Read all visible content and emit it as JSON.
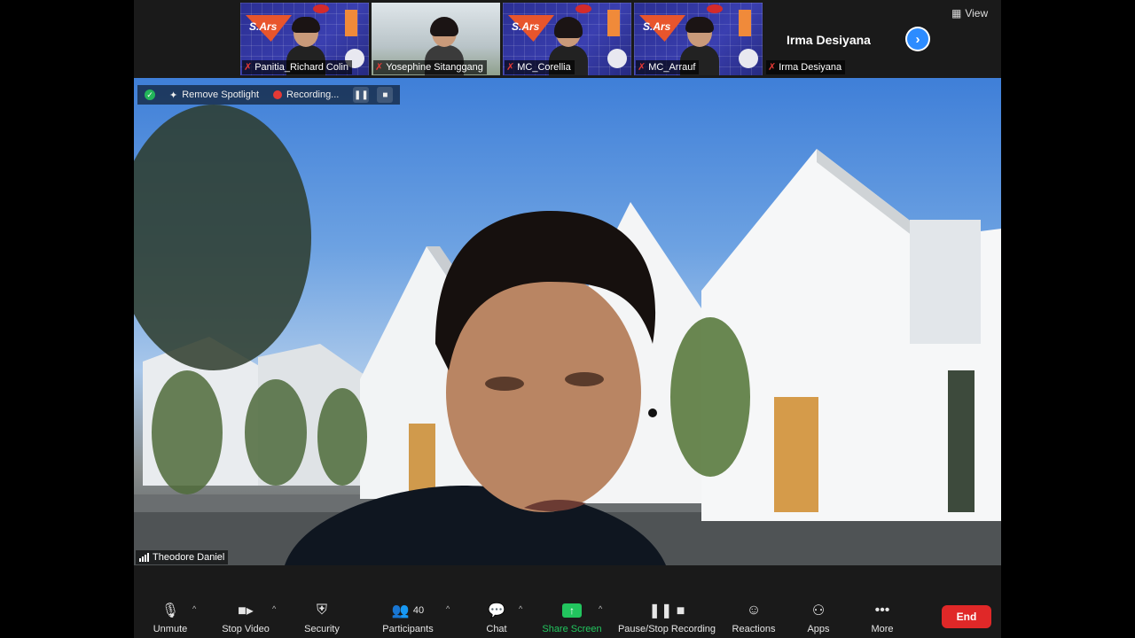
{
  "thumbnails": [
    {
      "name": "Panitia_Richard Colin",
      "logo": "S.Ars"
    },
    {
      "name": "Yosephine Sitanggang",
      "logo": ""
    },
    {
      "name": "MC_Corellia",
      "logo": "S.Ars"
    },
    {
      "name": "MC_Arrauf",
      "logo": "S.Ars"
    },
    {
      "name": "Irma Desiyana",
      "display_name": "Irma Desiyana"
    }
  ],
  "view_label": "View",
  "recording_bar": {
    "remove_spotlight": "Remove Spotlight",
    "recording": "Recording..."
  },
  "speaker": {
    "name": "Theodore Daniel"
  },
  "toolbar": {
    "unmute": "Unmute",
    "stop_video": "Stop Video",
    "security": "Security",
    "participants": "Participants",
    "participants_count": "40",
    "chat": "Chat",
    "share_screen": "Share Screen",
    "pause_stop_recording": "Pause/Stop Recording",
    "reactions": "Reactions",
    "apps": "Apps",
    "more": "More",
    "end": "End"
  },
  "colors": {
    "share_green": "#22c55e",
    "end_red": "#e02828",
    "accent_blue": "#2d8cff",
    "recording_red": "#e53935"
  }
}
